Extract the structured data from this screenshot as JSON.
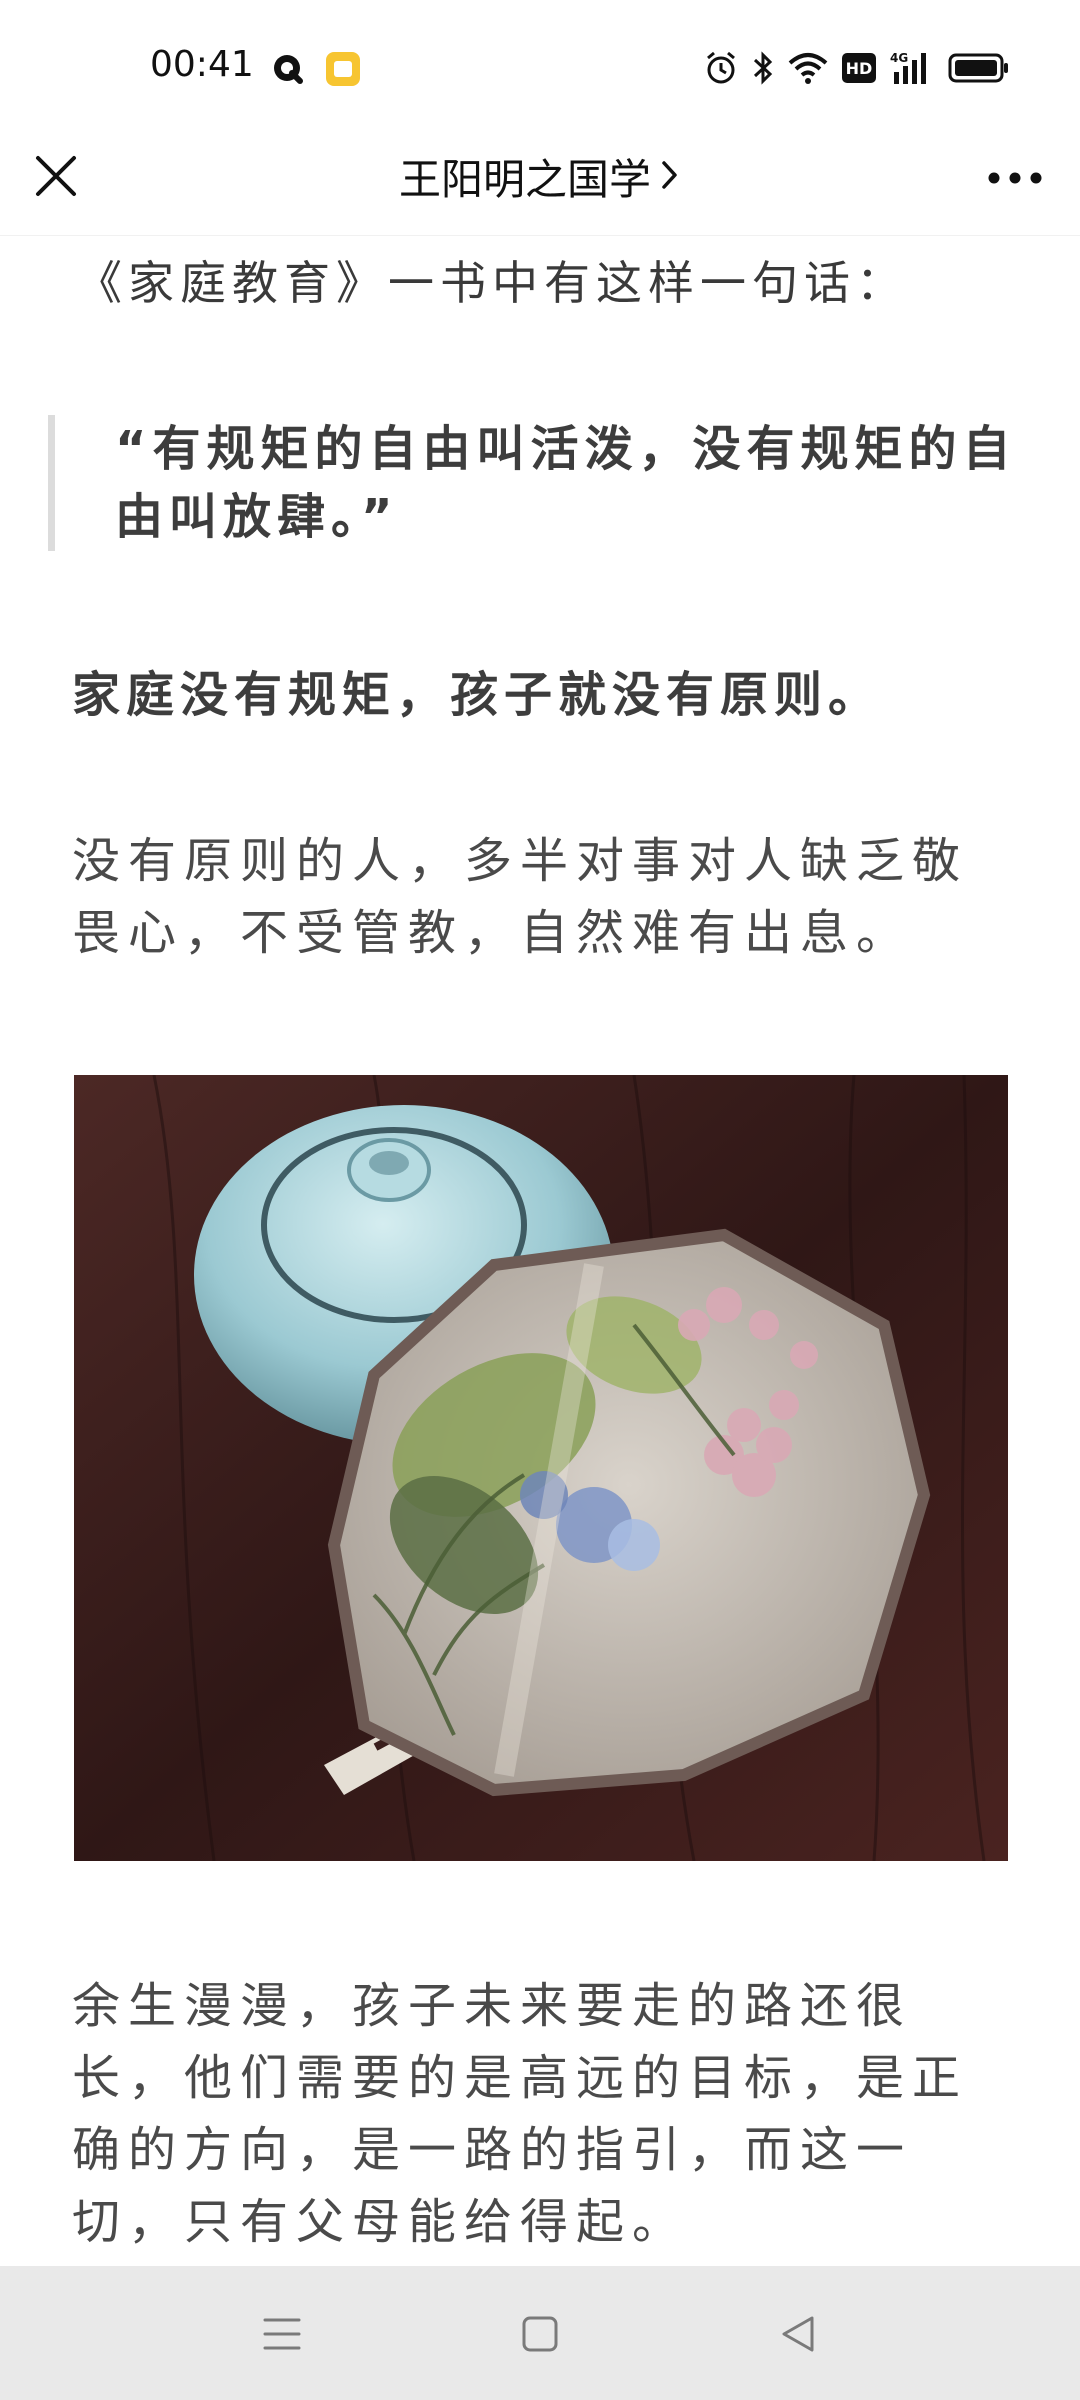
{
  "status_bar": {
    "time": "00:41",
    "network": "4G",
    "hd_badge": "HD",
    "icons": [
      "q-app-icon",
      "yellow-app-icon",
      "alarm-icon",
      "bluetooth-icon",
      "wifi-icon",
      "hd-icon",
      "signal-4g-icon",
      "battery-icon"
    ]
  },
  "nav": {
    "title": "王阳明之国学",
    "chevron": "›",
    "close_icon": "close-icon",
    "more_icon": "more-icon"
  },
  "article": {
    "intro": "《家庭教育》一书中有这样一句话：",
    "quote": "“有规矩的自由叫活泼，没有规矩的自由叫放肆。”",
    "bold_line": "家庭没有规矩，孩子就没有原则。",
    "paragraph1": "没有原则的人，多半对事对人缺乏敬畏心，不受管教，自然难有出息。",
    "image_desc": "photo",
    "paragraph2": "余生漫漫，孩子未来要走的路还很长，他们需要的是高远的目标，是正确的方向，是一路的指引，而这一切，只有父母能给得起。"
  },
  "system_nav": {
    "icons": [
      "menu-icon",
      "home-icon",
      "back-icon"
    ]
  },
  "colors": {
    "background": "#ffffff",
    "text": "#3d3d3d",
    "quote_border": "#dcdcdc",
    "system_nav_bg": "#e9e9e9"
  }
}
